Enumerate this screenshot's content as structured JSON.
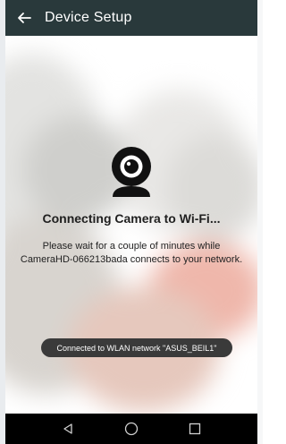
{
  "appbar": {
    "title": "Device Setup",
    "back_icon": "arrow-back-icon"
  },
  "main": {
    "icon": "webcam-icon",
    "heading": "Connecting Camera to Wi-Fi...",
    "description_line1": "Please wait for a couple of minutes while",
    "description_line2": "CameraHD-066213bada connects to your network."
  },
  "toast": {
    "text": "Connected to WLAN network \"ASUS_BEIL1\""
  },
  "navbar": {
    "back_icon": "nav-back-icon",
    "home_icon": "nav-home-icon",
    "recents_icon": "nav-recents-icon"
  },
  "colors": {
    "appbar": "#29393b",
    "navbar": "#000000",
    "toast": "#3a3a3a"
  }
}
